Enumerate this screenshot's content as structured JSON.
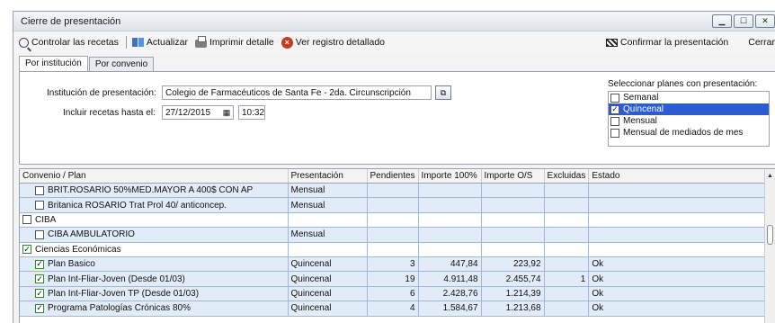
{
  "window": {
    "title": "Cierre de presentación"
  },
  "toolbar": {
    "controlar": "Controlar las recetas",
    "actualizar": "Actualizar",
    "imprimir": "Imprimir detalle",
    "ver_registro": "Ver registro detallado",
    "confirmar": "Confirmar la presentación",
    "cerrar": "Cerrar"
  },
  "tabs": [
    "Por institución",
    "Por convenio"
  ],
  "form": {
    "institucion_label": "Institución de presentación:",
    "institucion_value": "Colegio de Farmacéuticos de Santa Fe - 2da. Circunscripción",
    "incluir_label": "Incluir recetas hasta el:",
    "fecha_value": "27/12/2015",
    "hora_value": "10:32"
  },
  "planes": {
    "title": "Seleccionar planes con presentación:",
    "items": [
      {
        "label": "Semanal",
        "checked": false,
        "selected": false
      },
      {
        "label": "Quincenal",
        "checked": true,
        "selected": true
      },
      {
        "label": "Mensual",
        "checked": false,
        "selected": false
      },
      {
        "label": "Mensual de mediados de mes",
        "checked": false,
        "selected": false
      }
    ]
  },
  "grid": {
    "columns": [
      "Convenio / Plan",
      "Presentación",
      "Pendientes",
      "Importe 100%",
      "Importe O/S",
      "Excluidas",
      "Estado"
    ],
    "rows": [
      {
        "level": 2,
        "checked": false,
        "plan": "BRIT.ROSARIO 50%MED.MAYOR A 400$ CON AP",
        "presentacion": "Mensual",
        "pendientes": "",
        "importe100": "",
        "importeOS": "",
        "excluidas": "",
        "estado": "",
        "green": false
      },
      {
        "level": 2,
        "checked": false,
        "plan": "Britanica ROSARIO Trat Prol 40/ anticoncep.",
        "presentacion": "Mensual",
        "pendientes": "",
        "importe100": "",
        "importeOS": "",
        "excluidas": "",
        "estado": "",
        "green": false
      },
      {
        "level": 1,
        "checked": false,
        "plan": "CIBA",
        "presentacion": "",
        "pendientes": "",
        "importe100": "",
        "importeOS": "",
        "excluidas": "",
        "estado": "",
        "green": true
      },
      {
        "level": 2,
        "checked": false,
        "plan": "CIBA AMBULATORIO",
        "presentacion": "Mensual",
        "pendientes": "",
        "importe100": "",
        "importeOS": "",
        "excluidas": "",
        "estado": "",
        "green": false
      },
      {
        "level": 1,
        "checked": true,
        "plan": "Ciencias Económicas",
        "presentacion": "",
        "pendientes": "",
        "importe100": "",
        "importeOS": "",
        "excluidas": "",
        "estado": "",
        "green": true
      },
      {
        "level": 2,
        "checked": true,
        "plan": "Plan Basico",
        "presentacion": "Quincenal",
        "pendientes": "3",
        "importe100": "447,84",
        "importeOS": "223,92",
        "excluidas": "",
        "estado": "Ok",
        "green": false
      },
      {
        "level": 2,
        "checked": true,
        "plan": "Plan Int-Fliar-Joven (Desde 01/03)",
        "presentacion": "Quincenal",
        "pendientes": "19",
        "importe100": "4.911,48",
        "importeOS": "2.455,74",
        "excluidas": "1",
        "estado": "Ok",
        "green": false
      },
      {
        "level": 2,
        "checked": true,
        "plan": "Plan Int-Fliar-Joven TP (Desde 01/03)",
        "presentacion": "Quincenal",
        "pendientes": "6",
        "importe100": "2.428,76",
        "importeOS": "1.214,39",
        "excluidas": "",
        "estado": "Ok",
        "green": false
      },
      {
        "level": 2,
        "checked": true,
        "plan": "Programa Patologías Crónicas 80%",
        "presentacion": "Quincenal",
        "pendientes": "4",
        "importe100": "1.584,67",
        "importeOS": "1.213,68",
        "excluidas": "",
        "estado": "Ok",
        "green": false
      }
    ]
  }
}
